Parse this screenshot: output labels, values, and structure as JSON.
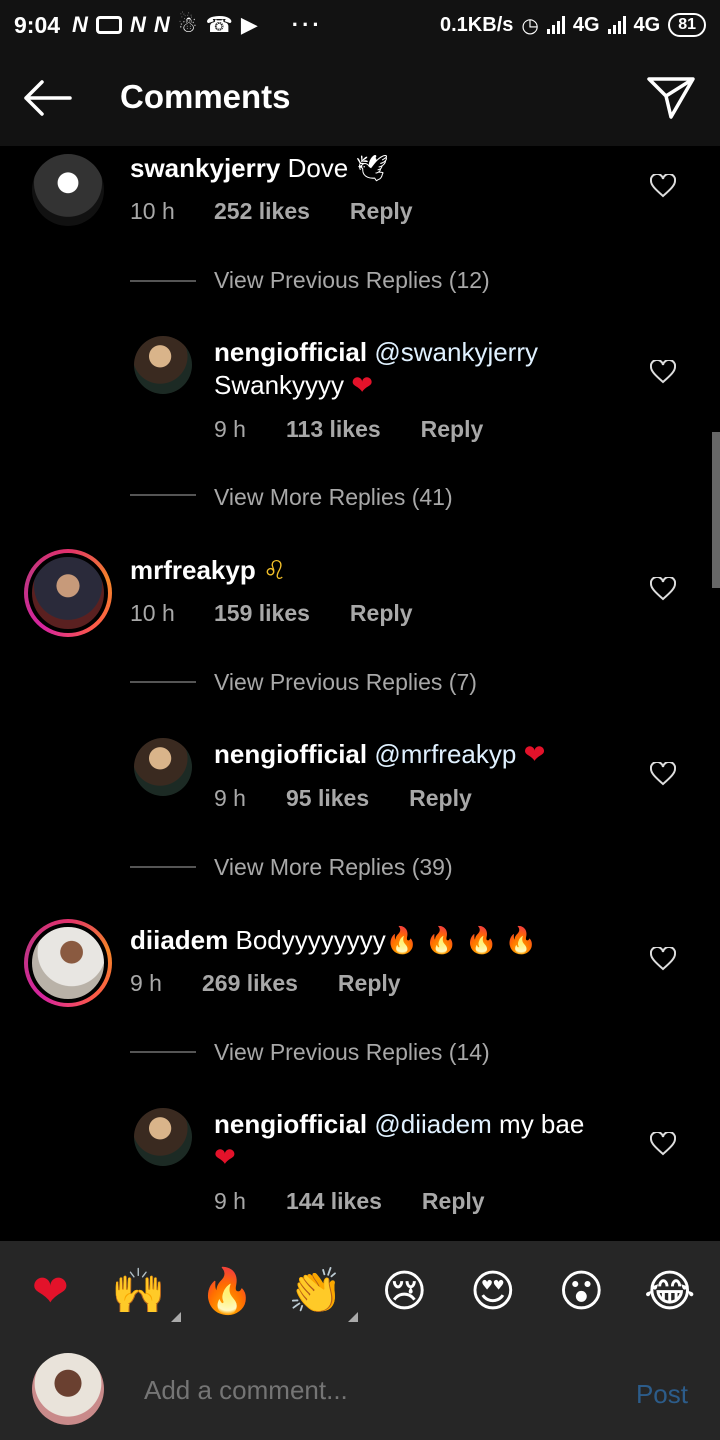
{
  "status_bar": {
    "time": "9:04",
    "net_speed": "0.1KB/s",
    "network1": "4G",
    "network2": "4G",
    "battery": "81",
    "dots": "···"
  },
  "header": {
    "title": "Comments"
  },
  "comments": [
    {
      "user": "swankyjerry",
      "text": "Dove 🕊",
      "time": "10 h",
      "likes": "252 likes",
      "reply": "Reply",
      "view_previous": "View Previous Replies (12)",
      "reply_user": "nengiofficial",
      "reply_mention": "@swankyjerry",
      "reply_text": "Swankyyyy",
      "reply_emoji": "❤",
      "reply_time": "9 h",
      "reply_likes": "113 likes",
      "reply_reply": "Reply",
      "view_more": "View More Replies (41)"
    },
    {
      "user": "mrfreakyp",
      "text": "♌",
      "time": "10 h",
      "likes": "159 likes",
      "reply": "Reply",
      "view_previous": "View Previous Replies (7)",
      "reply_user": "nengiofficial",
      "reply_mention": "@mrfreakyp",
      "reply_emoji": "❤",
      "reply_time": "9 h",
      "reply_likes": "95 likes",
      "reply_reply": "Reply",
      "view_more": "View More Replies (39)"
    },
    {
      "user": "diiadem",
      "text": "Bodyyyyyyyy",
      "text_emoji": "🔥 🔥 🔥 🔥",
      "time": "9 h",
      "likes": "269 likes",
      "reply": "Reply",
      "view_previous": "View Previous Replies (14)",
      "reply_user": "nengiofficial",
      "reply_mention": "@diiadem",
      "reply_text": "my bae",
      "reply_emoji": "❤",
      "reply_time": "9 h",
      "reply_likes": "144 likes",
      "reply_reply": "Reply"
    }
  ],
  "emoji_bar": [
    "❤",
    "🙌",
    "🔥",
    "👏",
    "😢",
    "😍",
    "😮",
    "😂"
  ],
  "composer": {
    "placeholder": "Add a comment...",
    "post": "Post"
  },
  "colors": {
    "background": "#000000",
    "bar_background": "#262626",
    "muted_text": "#a8a8a8",
    "post_link": "#2c5c8a",
    "heart_red": "#e3122a"
  }
}
